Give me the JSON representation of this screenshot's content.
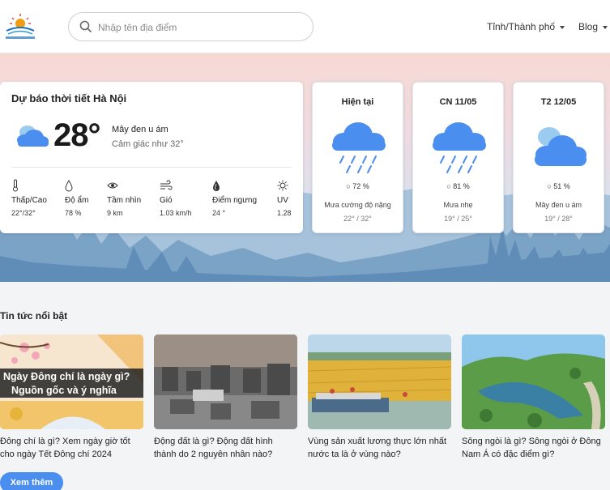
{
  "search": {
    "placeholder": "Nhập tên địa điểm"
  },
  "nav": {
    "provinces": "Tỉnh/Thành phố",
    "blog": "Blog"
  },
  "current": {
    "title": "Dự báo thời tiết Hà Nội",
    "temp": "28°",
    "desc": "Mây đen u ám",
    "feels_like": "Cảm giác như 32°",
    "stats": [
      {
        "icon": "thermometer-icon",
        "label": "Thấp/Cao",
        "value": "22°/32°"
      },
      {
        "icon": "droplet-icon",
        "label": "Độ ẩm",
        "value": "78 %"
      },
      {
        "icon": "eye-icon",
        "label": "Tầm nhìn",
        "value": "9 km"
      },
      {
        "icon": "wind-icon",
        "label": "Gió",
        "value": "1.03 km/h"
      },
      {
        "icon": "dew-point-icon",
        "label": "Điểm ngưng",
        "value": "24 °"
      },
      {
        "icon": "sun-icon",
        "label": "UV",
        "value": "1.28"
      }
    ]
  },
  "forecast": [
    {
      "label": "Hiện tại",
      "icon": "rain-cloud-icon",
      "humidity": "72 %",
      "desc": "Mưa cường độ nặng",
      "range": "22° / 32°"
    },
    {
      "label": "CN 11/05",
      "icon": "rain-cloud-icon",
      "humidity": "81 %",
      "desc": "Mưa nhẹ",
      "range": "19° / 25°"
    },
    {
      "label": "T2 12/05",
      "icon": "overcast-cloud-icon",
      "humidity": "51 %",
      "desc": "Mây đen u ám",
      "range": "19° / 28°"
    }
  ],
  "news": {
    "title": "Tin tức nổi bật",
    "items": [
      {
        "title": "Đông chí là gì? Xem ngày giờ tốt cho ngày Tết Đông chí 2024",
        "overlay_line1": "Ngày Đông chí là ngày gì?",
        "overlay_line2": "Nguồn gốc và ý nghĩa"
      },
      {
        "title": "Động đất là gì? Động đất hình thành do 2 nguyên nhân nào?"
      },
      {
        "title": "Vùng sản xuất lương thực lớn nhất nước ta là ở vùng nào?"
      },
      {
        "title": "Sông ngòi là gì? Sông ngòi ở Đông Nam Á có đặc điểm gì?"
      }
    ],
    "more": "Xem thêm"
  },
  "colors": {
    "accent": "#4a8ef0",
    "cloud": "#4a8ef0",
    "cloud_light": "#9ccbf0"
  }
}
